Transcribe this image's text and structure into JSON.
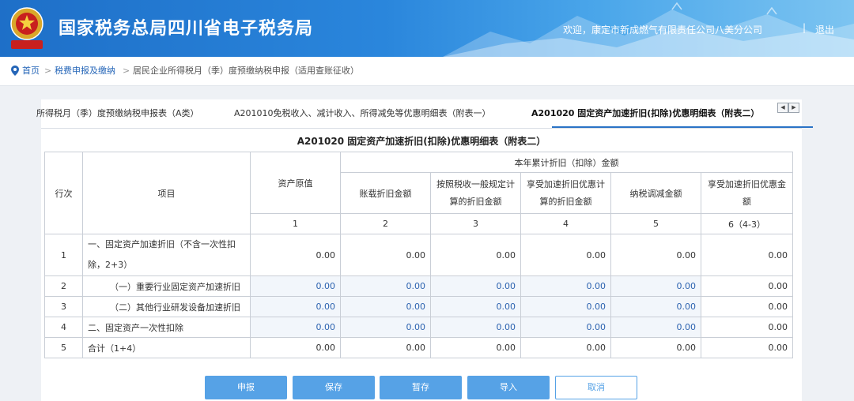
{
  "header": {
    "site_title": "国家税务总局四川省电子税务局",
    "welcome": "欢迎，康定市新成燃气有限责任公司八美分公司",
    "separator": "|",
    "logout": "退出",
    "emblem_text": "中国税务"
  },
  "breadcrumb": {
    "home": "首页",
    "arrow": ">",
    "level1": "税费申报及缴纳",
    "level2": "居民企业所得税月（季）度预缴纳税申报（适用查账征收）"
  },
  "tabs": [
    {
      "label": "所得税月（季）度预缴纳税申报表（A类）"
    },
    {
      "label": "A201010免税收入、减计收入、所得减免等优惠明细表（附表一）"
    },
    {
      "label": "A201020 固定资产加速折旧(扣除)优惠明细表（附表二）"
    }
  ],
  "tab_scroll": {
    "left": "◀",
    "right": "▶"
  },
  "report": {
    "title": "A201020 固定资产加速折旧(扣除)优惠明细表（附表二）",
    "headers": {
      "row_no": "行次",
      "item": "项目",
      "asset_value": "资产原值",
      "group": "本年累计折旧（扣除）金额",
      "c2": "账载折旧金额",
      "c3": "按照税收一般规定计算的折旧金额",
      "c4": "享受加速折旧优惠计算的折旧金额",
      "c5": "纳税调减金额",
      "c6": "享受加速折旧优惠金额"
    },
    "col_numbers": [
      "1",
      "2",
      "3",
      "4",
      "5",
      "6（4-3）"
    ],
    "rows": [
      {
        "no": "1",
        "item": "一、固定资产加速折旧（不含一次性扣除，2+3）",
        "values": [
          "0.00",
          "0.00",
          "0.00",
          "0.00",
          "0.00",
          "0.00"
        ]
      },
      {
        "no": "2",
        "item": "（一）重要行业固定资产加速折旧",
        "values": [
          "0.00",
          "0.00",
          "0.00",
          "0.00",
          "0.00",
          "0.00"
        ]
      },
      {
        "no": "3",
        "item": "（二）其他行业研发设备加速折旧",
        "values": [
          "0.00",
          "0.00",
          "0.00",
          "0.00",
          "0.00",
          "0.00"
        ]
      },
      {
        "no": "4",
        "item": "二、固定资产一次性扣除",
        "values": [
          "0.00",
          "0.00",
          "0.00",
          "0.00",
          "0.00",
          "0.00"
        ]
      },
      {
        "no": "5",
        "item": "合计（1+4）",
        "values": [
          "0.00",
          "0.00",
          "0.00",
          "0.00",
          "0.00",
          "0.00"
        ]
      }
    ]
  },
  "buttons": {
    "declare": "申报",
    "save": "保存",
    "temp_save": "暂存",
    "import": "导入",
    "cancel": "取消"
  },
  "colors": {
    "header_blue": "#1e6fc8",
    "button_blue": "#56a2e6",
    "link_blue": "#2566b8",
    "editable_cell_text": "#2d63b0"
  }
}
